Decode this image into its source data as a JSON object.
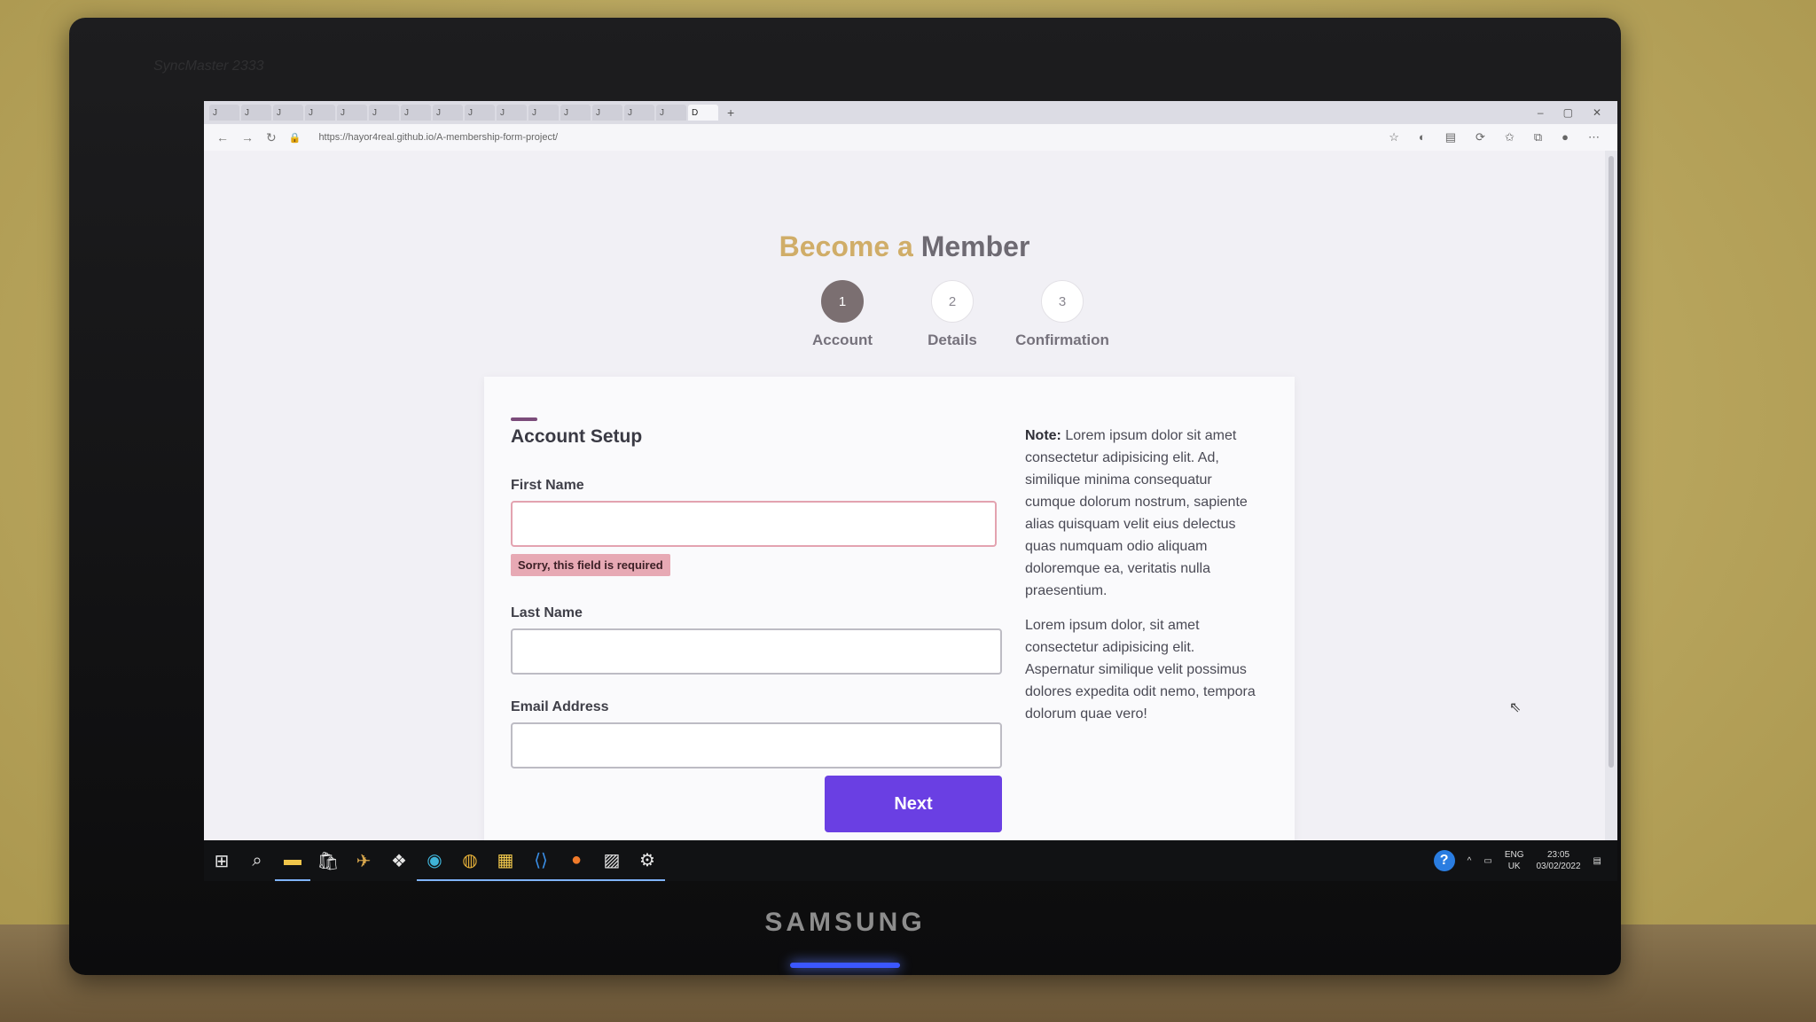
{
  "monitor": {
    "brand": "SAMSUNG",
    "model": "SyncMaster 2333"
  },
  "browser": {
    "url": "https://hayor4real.github.io/A-membership-form-project/",
    "tabs": [
      "J",
      "J",
      "J",
      "J",
      "J",
      "J",
      "J",
      "J",
      "J",
      "J",
      "J",
      "J",
      "J",
      "J",
      "J",
      "D"
    ],
    "window_controls": [
      "–",
      "▢",
      "✕"
    ]
  },
  "page": {
    "title_prefix": "Become a ",
    "title_main": "Member",
    "steps": [
      {
        "number": "1",
        "label": "Account"
      },
      {
        "number": "2",
        "label": "Details"
      },
      {
        "number": "3",
        "label": "Confirmation"
      }
    ],
    "form": {
      "heading": "Account Setup",
      "first_name_label": "First Name",
      "first_name_value": "",
      "first_name_error": "Sorry, this field is required",
      "last_name_label": "Last Name",
      "last_name_value": "",
      "email_label": "Email Address",
      "email_value": "",
      "next_label": "Next"
    },
    "note": {
      "label": "Note:",
      "paragraph1": "Lorem ipsum dolor sit amet consectetur adipisicing elit. Ad, similique minima consequatur cumque dolorum nostrum, sapiente alias quisquam velit eius delectus quas numquam odio aliquam doloremque ea, veritatis nulla praesentium.",
      "paragraph2": "Lorem ipsum dolor, sit amet consectetur adipisicing elit. Aspernatur similique velit possimus dolores expedita odit nemo, tempora dolorum quae vero!"
    }
  },
  "taskbar": {
    "language": "ENG",
    "region": "UK",
    "time": "23:05",
    "date": "03/02/2022"
  },
  "colors": {
    "accent_purple": "#6a3fe3",
    "error_pink": "#e7a9b4",
    "title_gold": "#d0ad68"
  }
}
